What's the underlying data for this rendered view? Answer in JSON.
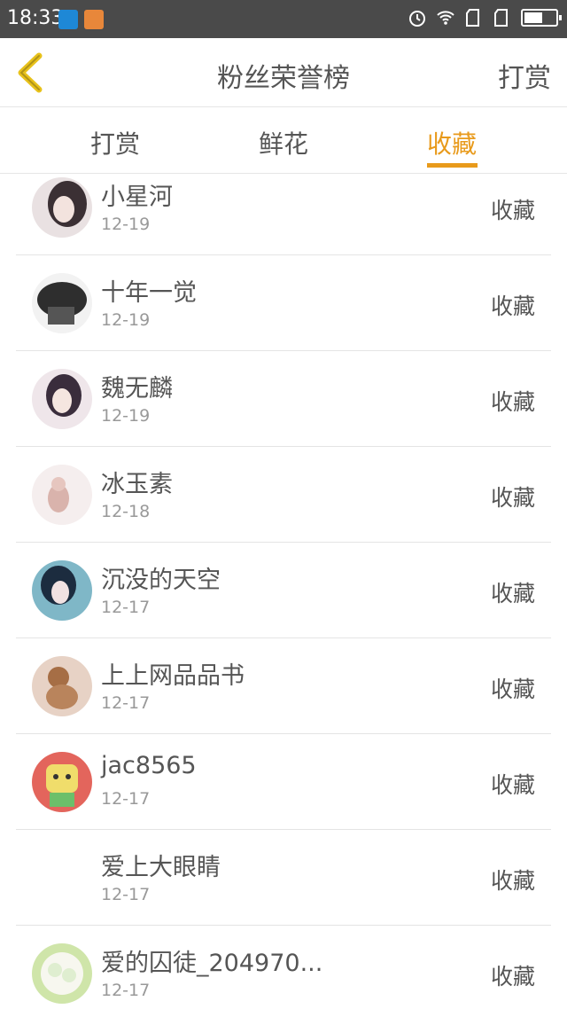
{
  "status_bar": {
    "time": "18:33",
    "icons": [
      "screenshot-app-icon",
      "notification-app-icon",
      "alarm-icon",
      "wifi-icon",
      "signal-icon",
      "signal-icon",
      "battery-icon"
    ]
  },
  "nav": {
    "title": "粉丝荣誉榜",
    "right_action": "打赏",
    "back_icon": "chevron-left-icon",
    "accent_color": "#e89a1b"
  },
  "tabs": [
    {
      "label": "打赏",
      "active": false
    },
    {
      "label": "鲜花",
      "active": false
    },
    {
      "label": "收藏",
      "active": true
    }
  ],
  "fans": [
    {
      "name": "小星河",
      "date": "12-19",
      "action": "收藏",
      "avatar_colors": [
        "#e9e1e2",
        "#3b3034"
      ]
    },
    {
      "name": "十年一觉",
      "date": "12-19",
      "action": "收藏",
      "avatar_colors": [
        "#d8d8d8",
        "#2e2e2e"
      ]
    },
    {
      "name": "魏无麟",
      "date": "12-19",
      "action": "收藏",
      "avatar_colors": [
        "#efe6ea",
        "#3a2d3c"
      ]
    },
    {
      "name": "冰玉素",
      "date": "12-18",
      "action": "收藏",
      "avatar_colors": [
        "#f5eeee",
        "#d9b3ac"
      ]
    },
    {
      "name": "沉没的天空",
      "date": "12-17",
      "action": "收藏",
      "avatar_colors": [
        "#7fb7c7",
        "#1c2c3f"
      ]
    },
    {
      "name": "上上网品品书",
      "date": "12-17",
      "action": "收藏",
      "avatar_colors": [
        "#e7d2c5",
        "#a66e45"
      ]
    },
    {
      "name": "jac8565",
      "date": "12-17",
      "action": "收藏",
      "avatar_colors": [
        "#f0dd6b",
        "#e3655c"
      ]
    },
    {
      "name": "爱上大眼睛",
      "date": "12-17",
      "action": "收藏",
      "avatar_colors": null
    },
    {
      "name": "爱的囚徒_204970...",
      "date": "12-17",
      "action": "收藏",
      "avatar_colors": [
        "#cfe5a9",
        "#2d4a28"
      ]
    }
  ]
}
